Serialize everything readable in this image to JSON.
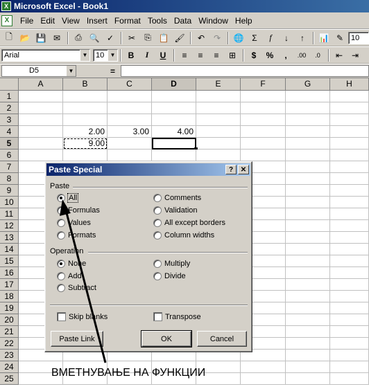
{
  "window": {
    "title": "Microsoft Excel - Book1"
  },
  "menu": [
    "File",
    "Edit",
    "View",
    "Insert",
    "Format",
    "Tools",
    "Data",
    "Window",
    "Help"
  ],
  "format_toolbar": {
    "font_name": "Arial",
    "font_size": "10",
    "zoom": "10"
  },
  "formula_bar": {
    "name_box": "D5",
    "equals": "="
  },
  "columns": [
    "A",
    "B",
    "C",
    "D",
    "E",
    "F",
    "G",
    "H"
  ],
  "rows": [
    "1",
    "2",
    "3",
    "4",
    "5",
    "6",
    "7",
    "8",
    "9",
    "10",
    "11",
    "12",
    "13",
    "14",
    "15",
    "16",
    "17",
    "18",
    "19",
    "20",
    "21",
    "22",
    "23",
    "24",
    "25"
  ],
  "cells": {
    "B4": "2.00",
    "C4": "3.00",
    "D4": "4.00",
    "B5": "9.00"
  },
  "active_cell": "D5",
  "copy_range": "B5",
  "dialog": {
    "title": "Paste Special",
    "paste_group": "Paste",
    "paste_options": [
      "All",
      "Formulas",
      "Values",
      "Formats",
      "Comments",
      "Validation",
      "All except borders",
      "Column widths"
    ],
    "paste_selected": "All",
    "operation_group": "Operation",
    "operation_options": [
      "None",
      "Add",
      "Subtract",
      "Multiply",
      "Divide"
    ],
    "operation_selected": "None",
    "skip_blanks": "Skip blanks",
    "transpose": "Transpose",
    "paste_link": "Paste Link",
    "ok": "OK",
    "cancel": "Cancel",
    "help_btn": "?",
    "close_btn": "✕"
  },
  "caption": "ВМЕТНУВАЊЕ НА ФУНКЦИИ"
}
